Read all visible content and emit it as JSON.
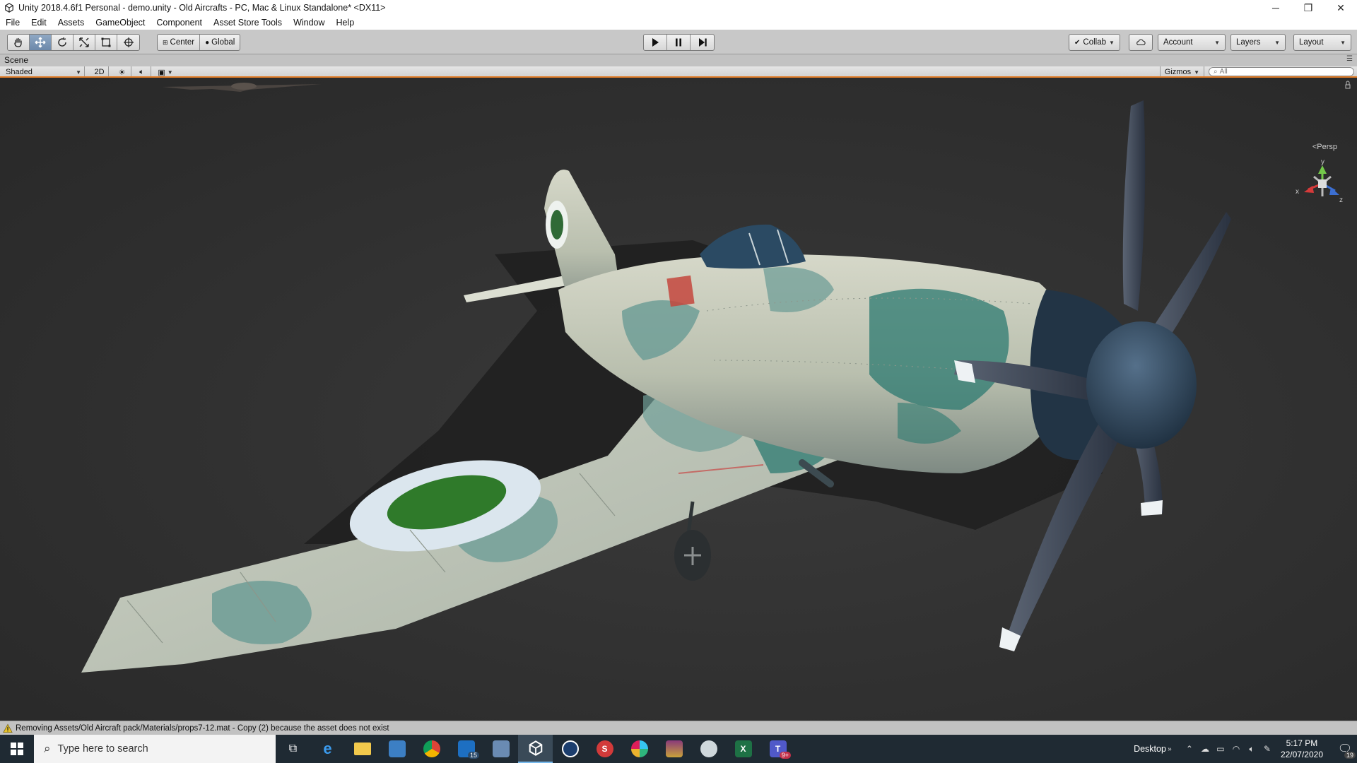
{
  "window": {
    "title": "Unity 2018.4.6f1 Personal - demo.unity - Old Aircrafts - PC, Mac & Linux Standalone* <DX11>",
    "controls": {
      "minimize": "─",
      "restore": "❐",
      "close": "✕"
    }
  },
  "menu": [
    "File",
    "Edit",
    "Assets",
    "GameObject",
    "Component",
    "Asset Store Tools",
    "Window",
    "Help"
  ],
  "toolbar": {
    "transform_tools": [
      "hand-icon",
      "move-icon",
      "rotate-icon",
      "scale-icon",
      "rect-icon",
      "transform-icon"
    ],
    "active_tool": "move-icon",
    "pivot_mode": "Center",
    "pivot_rotation": "Global",
    "playback": [
      "play-icon",
      "pause-icon",
      "step-icon"
    ],
    "collab": "Collab",
    "account": "Account",
    "layers": "Layers",
    "layout": "Layout"
  },
  "scene": {
    "tab_label": "Scene",
    "shading_mode": "Shaded",
    "mode_2d": "2D",
    "gizmos": "Gizmos",
    "search_placeholder": "All",
    "projection": "Persp",
    "axes": {
      "x": "x",
      "y": "y",
      "z": "z"
    }
  },
  "status": {
    "message": "Removing Assets/Old Aircraft pack/Materials/props7-12.mat - Copy (2) because the asset does not exist"
  },
  "taskbar": {
    "search_placeholder": "Type here to search",
    "apps": [
      {
        "name": "task-view",
        "label": ""
      },
      {
        "name": "edge",
        "label": "e"
      },
      {
        "name": "file-explorer",
        "label": ""
      },
      {
        "name": "store",
        "label": ""
      },
      {
        "name": "chrome",
        "label": ""
      },
      {
        "name": "mail",
        "label": "",
        "badge": "15"
      },
      {
        "name": "remote-desktop",
        "label": ""
      },
      {
        "name": "unity",
        "label": ""
      },
      {
        "name": "cinema4d",
        "label": ""
      },
      {
        "name": "substance",
        "label": "S"
      },
      {
        "name": "slack",
        "label": ""
      },
      {
        "name": "winrar",
        "label": ""
      },
      {
        "name": "paint",
        "label": ""
      },
      {
        "name": "excel",
        "label": "X"
      },
      {
        "name": "teams",
        "label": "T",
        "badge": "9+"
      }
    ],
    "desktop_label": "Desktop",
    "time": "5:17 PM",
    "date": "22/07/2020",
    "notifications": "19"
  },
  "colors": {
    "accent_orange": "#e07c28",
    "viewport_bg": "#303030",
    "taskbar_bg": "#1f2a33",
    "plane_camo_light": "#c9cdb9",
    "plane_camo_dark": "#6f9e97",
    "roundel_green": "#2f7a2a"
  }
}
